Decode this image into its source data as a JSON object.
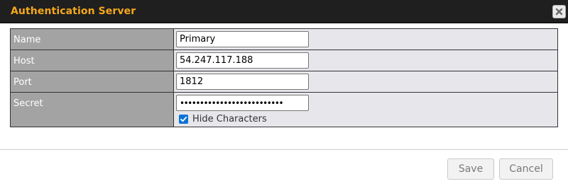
{
  "dialog": {
    "title": "Authentication Server",
    "close_icon": "close-icon"
  },
  "form": {
    "name": {
      "label": "Name",
      "value": "Primary"
    },
    "host": {
      "label": "Host",
      "value": "54.247.117.188"
    },
    "port": {
      "label": "Port",
      "value": "1812"
    },
    "secret": {
      "label": "Secret",
      "value": "••••••••••••••••••••••••••",
      "hide_characters_label": "Hide Characters",
      "hide_characters_checked": true
    }
  },
  "footer": {
    "save_label": "Save",
    "cancel_label": "Cancel"
  },
  "colors": {
    "title": "#f5a81c",
    "titlebar_bg": "#1f1f1f",
    "label_bg": "#a3a3a3",
    "value_bg": "#e7e6eb",
    "checkbox": "#0a74d6"
  }
}
